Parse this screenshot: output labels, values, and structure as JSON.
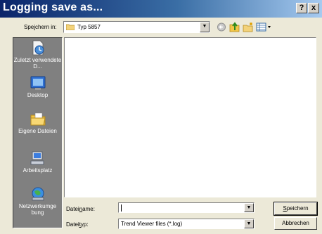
{
  "window": {
    "title": "Logging save as...",
    "help_label": "?",
    "close_label": "x"
  },
  "save_in": {
    "label_pre": "Spe",
    "label_key": "i",
    "label_post": "chern in:",
    "value": "Typ 5857",
    "dropdown_glyph": "▼"
  },
  "toolbar": {
    "back_icon": "back-arrow-icon",
    "up_icon": "folder-up-icon",
    "new_folder_icon": "new-folder-icon",
    "view_menu_icon": "view-menu-icon"
  },
  "places": [
    {
      "label": "Zuletzt verwendete D...",
      "icon": "recent-documents-icon"
    },
    {
      "label": "Desktop",
      "icon": "desktop-icon"
    },
    {
      "label": "Eigene Dateien",
      "icon": "my-documents-icon"
    },
    {
      "label": "Arbeitsplatz",
      "icon": "my-computer-icon"
    },
    {
      "label": "Netzwerkumge bung",
      "icon": "network-places-icon"
    }
  ],
  "filename": {
    "label_pre": "Datei",
    "label_key": "n",
    "label_post": "ame:",
    "value": "",
    "dropdown_glyph": "▼"
  },
  "filetype": {
    "label_pre": "Datei",
    "label_key": "t",
    "label_post": "yp:",
    "value": "Trend Viewer files (*.log)",
    "dropdown_glyph": "▼"
  },
  "buttons": {
    "save_key": "S",
    "save_rest": "peichern",
    "cancel": "Abbrechen"
  },
  "colors": {
    "title_bar_start": "#0a246a",
    "title_bar_end": "#a6caf0",
    "places_bar": "#808080",
    "dialog_face": "#ece9d8"
  }
}
